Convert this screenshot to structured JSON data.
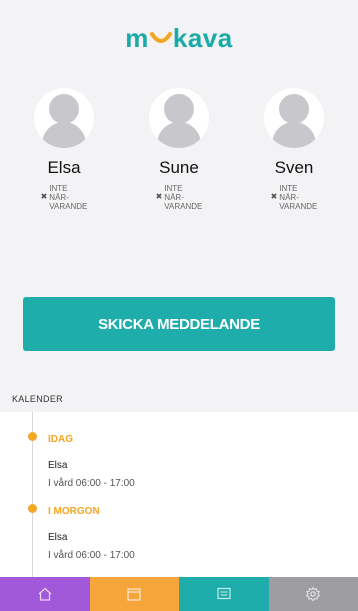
{
  "app": {
    "logo_left": "m",
    "logo_right": "kava"
  },
  "children": [
    {
      "name": "Elsa",
      "status_x": "✖",
      "status": "INTE\nNÄR-\nVARANDE"
    },
    {
      "name": "Sune",
      "status_x": "✖",
      "status": "INTE\nNÄR-\nVARANDE"
    },
    {
      "name": "Sven",
      "status_x": "✖",
      "status": "INTE\nNÄR-\nVARANDE"
    }
  ],
  "send_button": "SKICKA MEDDELANDE",
  "calendar": {
    "title": "KALENDER",
    "days": [
      {
        "label": "IDAG",
        "child": "Elsa",
        "time": "I vård  06:00 - 17:00"
      },
      {
        "label": "I MORGON",
        "child": "Elsa",
        "time": "I vård  06:00 - 17:00"
      }
    ]
  },
  "tabs": [
    {
      "icon": "home-icon",
      "color": "#a259d9"
    },
    {
      "icon": "calendar-icon",
      "color": "#f5a53b"
    },
    {
      "icon": "message-icon",
      "color": "#1fadab"
    },
    {
      "icon": "settings-icon",
      "color": "#9e9ea2"
    }
  ],
  "colors": {
    "accent": "#1fadab",
    "highlight": "#f5a623"
  }
}
